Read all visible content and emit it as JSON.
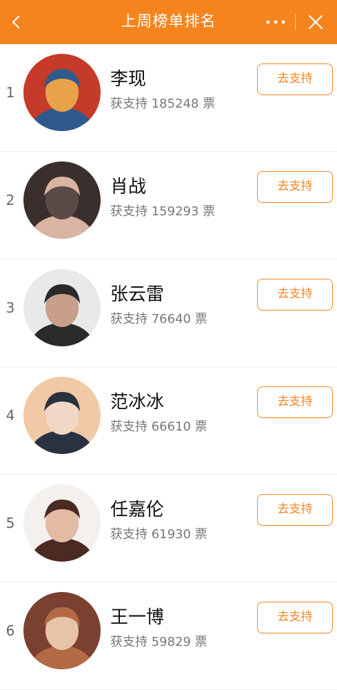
{
  "header": {
    "title": "上周榜单排名",
    "back_icon": "chevron-left-icon",
    "more_icon": "more-dots-icon",
    "close_icon": "close-icon",
    "color": "#f5841f"
  },
  "rankings": [
    {
      "rank": "1",
      "name": "李现",
      "votes": "获支持 185248 票",
      "button": "去支持",
      "avatar_colors": [
        "#c63a2a",
        "#2e5a8c",
        "#e8a24a"
      ]
    },
    {
      "rank": "2",
      "name": "肖战",
      "votes": "获支持 159293 票",
      "button": "去支持",
      "avatar_colors": [
        "#3a2f2c",
        "#d9b4a2",
        "#5a4a48"
      ]
    },
    {
      "rank": "3",
      "name": "张云雷",
      "votes": "获支持 76640 票",
      "button": "去支持",
      "avatar_colors": [
        "#e9e9ea",
        "#2a2a2a",
        "#c79f8a"
      ]
    },
    {
      "rank": "4",
      "name": "范冰冰",
      "votes": "获支持 66610 票",
      "button": "去支持",
      "avatar_colors": [
        "#f2c9a6",
        "#2a3240",
        "#f1d8c6"
      ]
    },
    {
      "rank": "5",
      "name": "任嘉伦",
      "votes": "获支持 61930 票",
      "button": "去支持",
      "avatar_colors": [
        "#f4f0ee",
        "#4a2a22",
        "#e3bba3"
      ]
    },
    {
      "rank": "6",
      "name": "王一博",
      "votes": "获支持 59829 票",
      "button": "去支持",
      "avatar_colors": [
        "#7a4030",
        "#b46a45",
        "#e7c3aa"
      ]
    }
  ]
}
